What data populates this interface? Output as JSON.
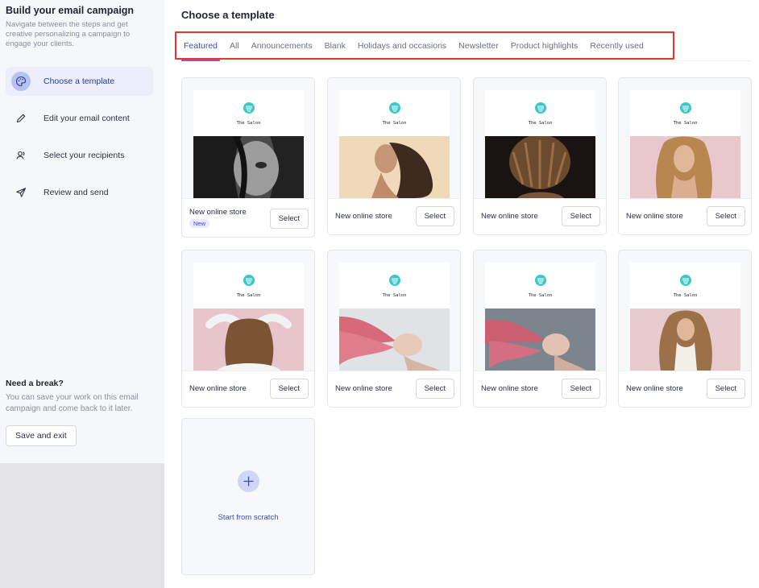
{
  "sidebar": {
    "title": "Build your email campaign",
    "description": "Navigate between the steps and get creative personalizing a campaign to engage your clients.",
    "steps": [
      {
        "label": "Choose a template",
        "icon": "palette-icon",
        "active": true
      },
      {
        "label": "Edit your email content",
        "icon": "pencil-icon",
        "active": false
      },
      {
        "label": "Select your recipients",
        "icon": "users-icon",
        "active": false
      },
      {
        "label": "Review and send",
        "icon": "send-icon",
        "active": false
      }
    ],
    "break_title": "Need a break?",
    "break_description": "You can save your work on this email campaign and come back to it later.",
    "save_label": "Save and exit"
  },
  "main": {
    "title": "Choose a template",
    "tabs": [
      {
        "label": "Featured",
        "active": true
      },
      {
        "label": "All",
        "active": false
      },
      {
        "label": "Announcements",
        "active": false
      },
      {
        "label": "Blank",
        "active": false
      },
      {
        "label": "Holidays and occasions",
        "active": false
      },
      {
        "label": "Newsletter",
        "active": false
      },
      {
        "label": "Product highlights",
        "active": false
      },
      {
        "label": "Recently used",
        "active": false
      }
    ],
    "brand_text": "The Salon",
    "select_label": "Select",
    "new_badge": "New",
    "templates": [
      {
        "name": "New online store",
        "badge": "New",
        "photo": "woman-dark-hair-face-bw"
      },
      {
        "name": "New online store",
        "photo": "woman-wavy-hair-profile"
      },
      {
        "name": "New online store",
        "photo": "dreadlocks-back-of-head"
      },
      {
        "name": "New online store",
        "photo": "woman-long-blonde-wavy-hair"
      },
      {
        "name": "New online store",
        "photo": "woman-hands-in-hair-back-view"
      },
      {
        "name": "New online store",
        "photo": "woman-pink-hair-flying"
      },
      {
        "name": "New online store",
        "photo": "woman-pink-hair-flying-2"
      },
      {
        "name": "New online store",
        "photo": "woman-long-curly-blonde-hair"
      }
    ],
    "scratch_label": "Start from scratch"
  },
  "colors": {
    "accent": "#3b4db3",
    "tab_underline": "#c441b6",
    "highlight_box": "#e0382e",
    "logo": "#3ec7c7"
  }
}
